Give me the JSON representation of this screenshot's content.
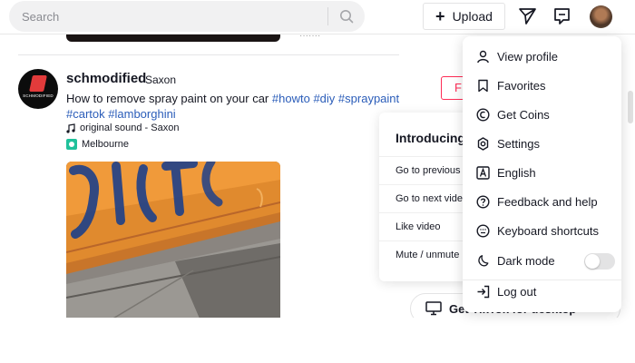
{
  "header": {
    "search_placeholder": "Search",
    "upload_label": "Upload",
    "icons": {
      "search": "search-icon",
      "plus": "plus-icon",
      "inbox": "paper-plane-icon",
      "messages": "message-icon",
      "avatar": "user-avatar"
    }
  },
  "previous_post": {
    "meta_fragment": "·······"
  },
  "post": {
    "author": "schmodified",
    "nickname": "Saxon",
    "avatar_text": "SCHMODIFIED",
    "caption_text": "How to remove spray paint on your car ",
    "hashtags_line1": [
      "#howto",
      "#diy",
      "#spraypaint"
    ],
    "hashtags_line2": [
      "#cartok",
      "#lamborghini"
    ],
    "sound": "original sound - Saxon",
    "location": "Melbourne",
    "follow_label": "F"
  },
  "keyboard_panel": {
    "title": "Introducing",
    "rows": [
      "Go to previous",
      "Go to next video",
      "Like video",
      "Mute / unmute"
    ]
  },
  "get_app": {
    "label": "Get TikTok for desktop",
    "close": "✕"
  },
  "menu": {
    "items": [
      {
        "label": "View profile",
        "icon": "person-icon"
      },
      {
        "label": "Favorites",
        "icon": "bookmark-icon"
      },
      {
        "label": "Get Coins",
        "icon": "coin-icon"
      },
      {
        "label": "Settings",
        "icon": "gear-icon"
      },
      {
        "label": "English",
        "icon": "language-icon"
      },
      {
        "label": "Feedback and help",
        "icon": "help-icon"
      },
      {
        "label": "Keyboard shortcuts",
        "icon": "keyboard-icon"
      },
      {
        "label": "Dark mode",
        "icon": "moon-icon"
      },
      {
        "label": "Log out",
        "icon": "logout-icon"
      }
    ],
    "dark_mode_on": false
  },
  "colors": {
    "accent": "#fe2c55",
    "hashtag": "#2b5db9",
    "text": "#161823"
  }
}
